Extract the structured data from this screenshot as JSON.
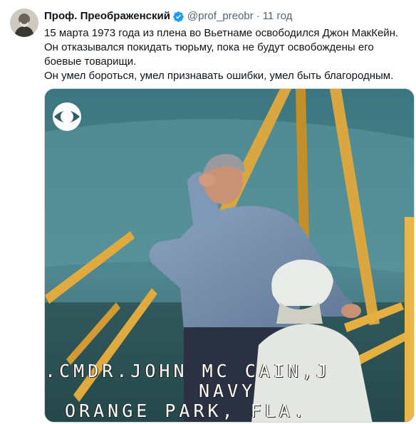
{
  "author": {
    "display_name": "Проф. Преображенский",
    "handle": "@prof_preobr",
    "separator": "·",
    "time": "11 год"
  },
  "tweet": {
    "lines": [
      "15 марта 1973 года из плена во Вьетнаме освободился Джон МакКейн.",
      "Он отказывался покидать тюрьму, пока не будут освобождены его",
      "боевые товарищи.",
      "Он умел бороться, умел признавать ошибки, умел быть благородным."
    ]
  },
  "media": {
    "caption_lines": [
      ".CMDR.JOHN MC CAIN,J",
      "NAVY",
      "ORANGE PARK, FLA."
    ]
  },
  "icons": {
    "verified": "verified-badge-icon",
    "logo": "cbs-eye-icon"
  },
  "colors": {
    "verified": "#1d9bf0",
    "secondary_text": "#536471",
    "primary_text": "#0f1419"
  }
}
